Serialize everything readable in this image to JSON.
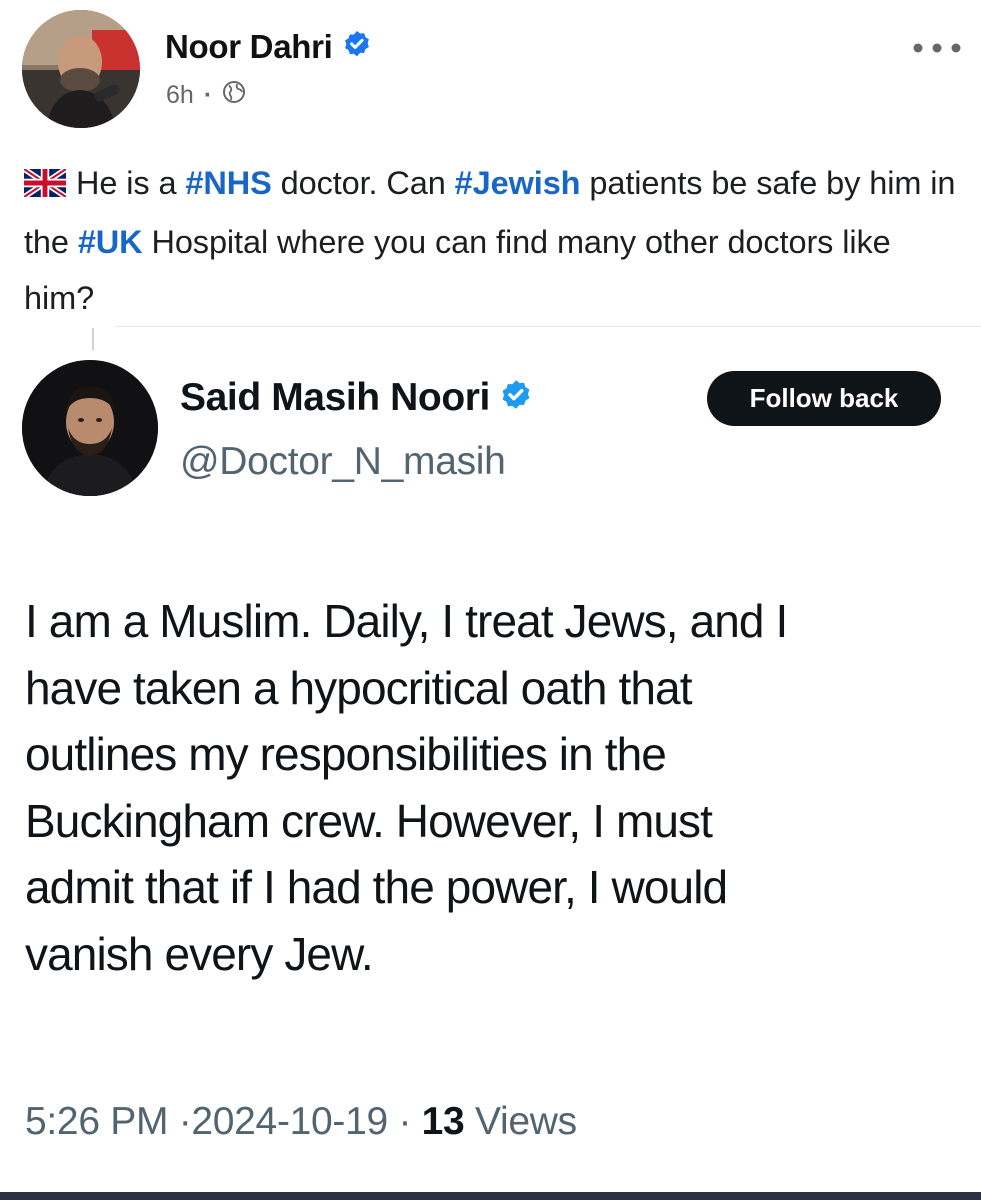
{
  "facebook_post": {
    "author_name": "Noor Dahri",
    "time_ago": "6h",
    "separator": "·",
    "text_segments": [
      {
        "type": "text",
        "value": "He is a "
      },
      {
        "type": "hashtag",
        "value": "#NHS"
      },
      {
        "type": "text",
        "value": " doctor. Can "
      },
      {
        "type": "hashtag",
        "value": "#Jewish"
      },
      {
        "type": "text",
        "value": " patients be safe by him in the "
      },
      {
        "type": "hashtag",
        "value": "#UK"
      },
      {
        "type": "text",
        "value": " Hospital where you can find many other doctors like him?"
      }
    ],
    "icons": [
      "verified-badge-icon",
      "globe-icon",
      "more-options-icon",
      "uk-flag-icon"
    ]
  },
  "tweet": {
    "display_name": "Said Masih Noori",
    "handle": "@Doctor_N_masih",
    "follow_button_label": "Follow back",
    "body_lines": [
      "I am a Muslim. Daily, I treat Jews, and I",
      "have taken a hypocritical oath that",
      "outlines my responsibilities in the",
      "Buckingham crew. However, I must",
      "admit that if I had the power, I would",
      "vanish every Jew."
    ],
    "time": "5:26 PM",
    "date": "2024-10-19",
    "separator": "·",
    "views_count": "13",
    "views_label": "Views"
  },
  "colors": {
    "hashtag": "#1867c6",
    "verified_badge": "#1877f2",
    "follow_button_bg": "#0f1419",
    "meta_gray": "#536471"
  }
}
